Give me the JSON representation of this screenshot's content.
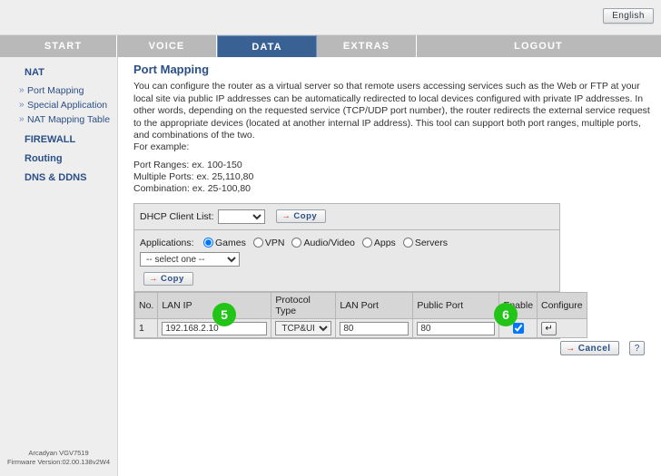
{
  "header": {
    "language_button": "English"
  },
  "mainnav": {
    "items": [
      {
        "label": "START",
        "active": false
      },
      {
        "label": "VOICE",
        "active": false
      },
      {
        "label": "DATA",
        "active": true
      },
      {
        "label": "EXTRAS",
        "active": false
      },
      {
        "label": "LOGOUT",
        "active": false
      }
    ]
  },
  "sidebar": {
    "groups": [
      {
        "label": "NAT",
        "type": "head"
      },
      {
        "label": "Port Mapping",
        "type": "sub"
      },
      {
        "label": "Special Application",
        "type": "sub"
      },
      {
        "label": "NAT Mapping Table",
        "type": "sub"
      },
      {
        "label": "FIREWALL",
        "type": "head"
      },
      {
        "label": "Routing",
        "type": "head"
      },
      {
        "label": "DNS & DDNS",
        "type": "head"
      }
    ],
    "footer": {
      "model": "Arcadyan VGV7519",
      "firmware": "Firmware Version:02.00.138v2W4"
    }
  },
  "main": {
    "title": "Port Mapping",
    "description": "You can configure the router as a virtual server so that remote users accessing services such as the Web or FTP at your local site via public IP addresses can be automatically redirected to local devices configured with private IP addresses. In other words, depending on the requested service (TCP/UDP port number), the router redirects the external service request to the appropriate devices (located at another internal IP address). This tool can support both port ranges, multiple ports, and combinations of the two.",
    "example_label": "For example:",
    "examples": "Port Ranges: ex. 100-150\nMultiple Ports: ex. 25,110,80\nCombination: ex. 25-100,80"
  },
  "dhcp_row": {
    "label": "DHCP Client List:",
    "select_value": "",
    "copy_label": "Copy",
    "copy_arrow": "→"
  },
  "applications_row": {
    "label": "Applications:",
    "options": [
      {
        "label": "Games",
        "checked": true
      },
      {
        "label": "VPN",
        "checked": false
      },
      {
        "label": "Audio/Video",
        "checked": false
      },
      {
        "label": "Apps",
        "checked": false
      },
      {
        "label": "Servers",
        "checked": false
      }
    ],
    "select_value": "-- select one --",
    "copy_label": "Copy",
    "copy_arrow": "→"
  },
  "table": {
    "headers": [
      "No.",
      "LAN IP",
      "Protocol Type",
      "LAN Port",
      "Public Port",
      "Enable",
      "Configure"
    ],
    "rows": [
      {
        "no": "1",
        "lan_ip": "192.168.2.10",
        "protocol": "TCP&UDP",
        "lan_port": "80",
        "public_port": "80",
        "enabled": true,
        "configure_icon": "↵"
      }
    ]
  },
  "markers": [
    {
      "number": "5"
    },
    {
      "number": "6"
    }
  ],
  "actions": {
    "cancel_label": "Cancel",
    "cancel_arrow": "→",
    "help_label": "?"
  },
  "colors": {
    "nav_active": "#3a6194",
    "nav_bg": "#b9b9b9",
    "link_blue": "#2b4f87",
    "marker_green": "#22c417",
    "arrow_red": "#cc2200"
  }
}
